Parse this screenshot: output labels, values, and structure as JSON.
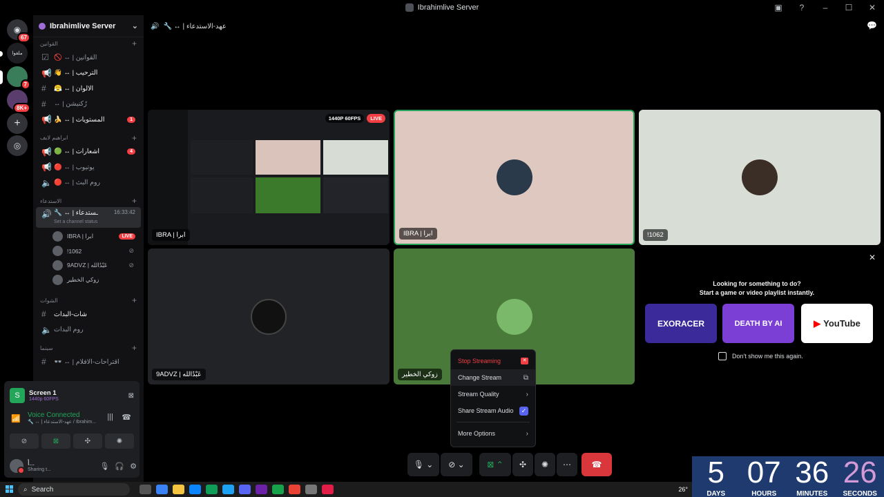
{
  "window": {
    "title": "Ibrahimlive Server"
  },
  "guilds": {
    "home_badge": "67",
    "server2_label": "ملفوا",
    "server3_badge": "7",
    "server4_badge": "8K+"
  },
  "server": {
    "name": "Ibrahimlive Server"
  },
  "sidebar": {
    "cat1": "القوانين",
    "ch1": {
      "name": "القوانين | ↔ 🚫"
    },
    "ch2": {
      "name": "الترحيب | ↔ 👋"
    },
    "ch3": {
      "name": "الالوان | ↔ 😤"
    },
    "ch4": {
      "name": "رُكنيشن | ↔"
    },
    "ch5": {
      "name": "المستويات | ↔ 🍌",
      "badge": "1"
    },
    "cat2": "ابراهيم لايف",
    "ch6": {
      "name": "اشعارات | ↔ 🟢",
      "badge": "4"
    },
    "ch7": {
      "name": "يوتيوب | ↔ 🔴"
    },
    "ch8": {
      "name": "روم البث | ↔ 🔴"
    },
    "cat3": "الاستدعاء",
    "voice": {
      "name": "ـستدعاء | ↔ 🔧",
      "time": "16:33:42",
      "status": "Set a channel status"
    },
    "users": [
      {
        "name": "IBRA | ابرا",
        "live": "LIVE"
      },
      {
        "name": "!1062"
      },
      {
        "name": "9ADVZ | عَبْدُالله"
      },
      {
        "name": "زوكي الخطير"
      }
    ],
    "cat4": "الشوات",
    "ch9": {
      "name": "شات-البدات"
    },
    "ch10": {
      "name": "روم البدات"
    },
    "cat5": "سينما",
    "ch11": {
      "name": "اقتراحات-الافلام | ↔ 👓"
    }
  },
  "panel": {
    "screen_title": "Screen 1",
    "screen_sub": "1440p 60FPS",
    "vc_title": "Voice Connected",
    "vc_sub": "🔧 ↔ | عهد-الاستدعاء / Ibrahim...",
    "user_name": "أ...",
    "user_status": "Sharing t..."
  },
  "main": {
    "channel": "🔧 ↔ | عهد-الاستدعاء",
    "tiles": [
      {
        "label": "IBRA | ابرا",
        "quality": "1440P 60FPS",
        "live": "LIVE"
      },
      {
        "label": "IBRA | ابرا"
      },
      {
        "label": "!1062"
      },
      {
        "label": "9ADVZ | عَبْدُالله"
      },
      {
        "label": "زوكي الخطير"
      }
    ],
    "prompt_line1": "Looking for something to do?",
    "prompt_line2": "Start a game or video playlist instantly.",
    "cards": [
      {
        "label": "EXORACER"
      },
      {
        "label": "DEATH BY AI"
      },
      {
        "label": "YouTube"
      }
    ],
    "dont_show": "Don't show me this again."
  },
  "menu": {
    "stop": "Stop Streaming",
    "change": "Change Stream",
    "quality": "Stream Quality",
    "audio": "Share Stream Audio",
    "more": "More Options"
  },
  "countdown": {
    "days": "5",
    "days_label": "DAYS",
    "hours": "07",
    "hours_label": "HOURS",
    "minutes": "36",
    "minutes_label": "MINUTES",
    "seconds": "26",
    "seconds_label": "SECONDS"
  },
  "taskbar": {
    "search": "Search",
    "temp": "26°"
  }
}
